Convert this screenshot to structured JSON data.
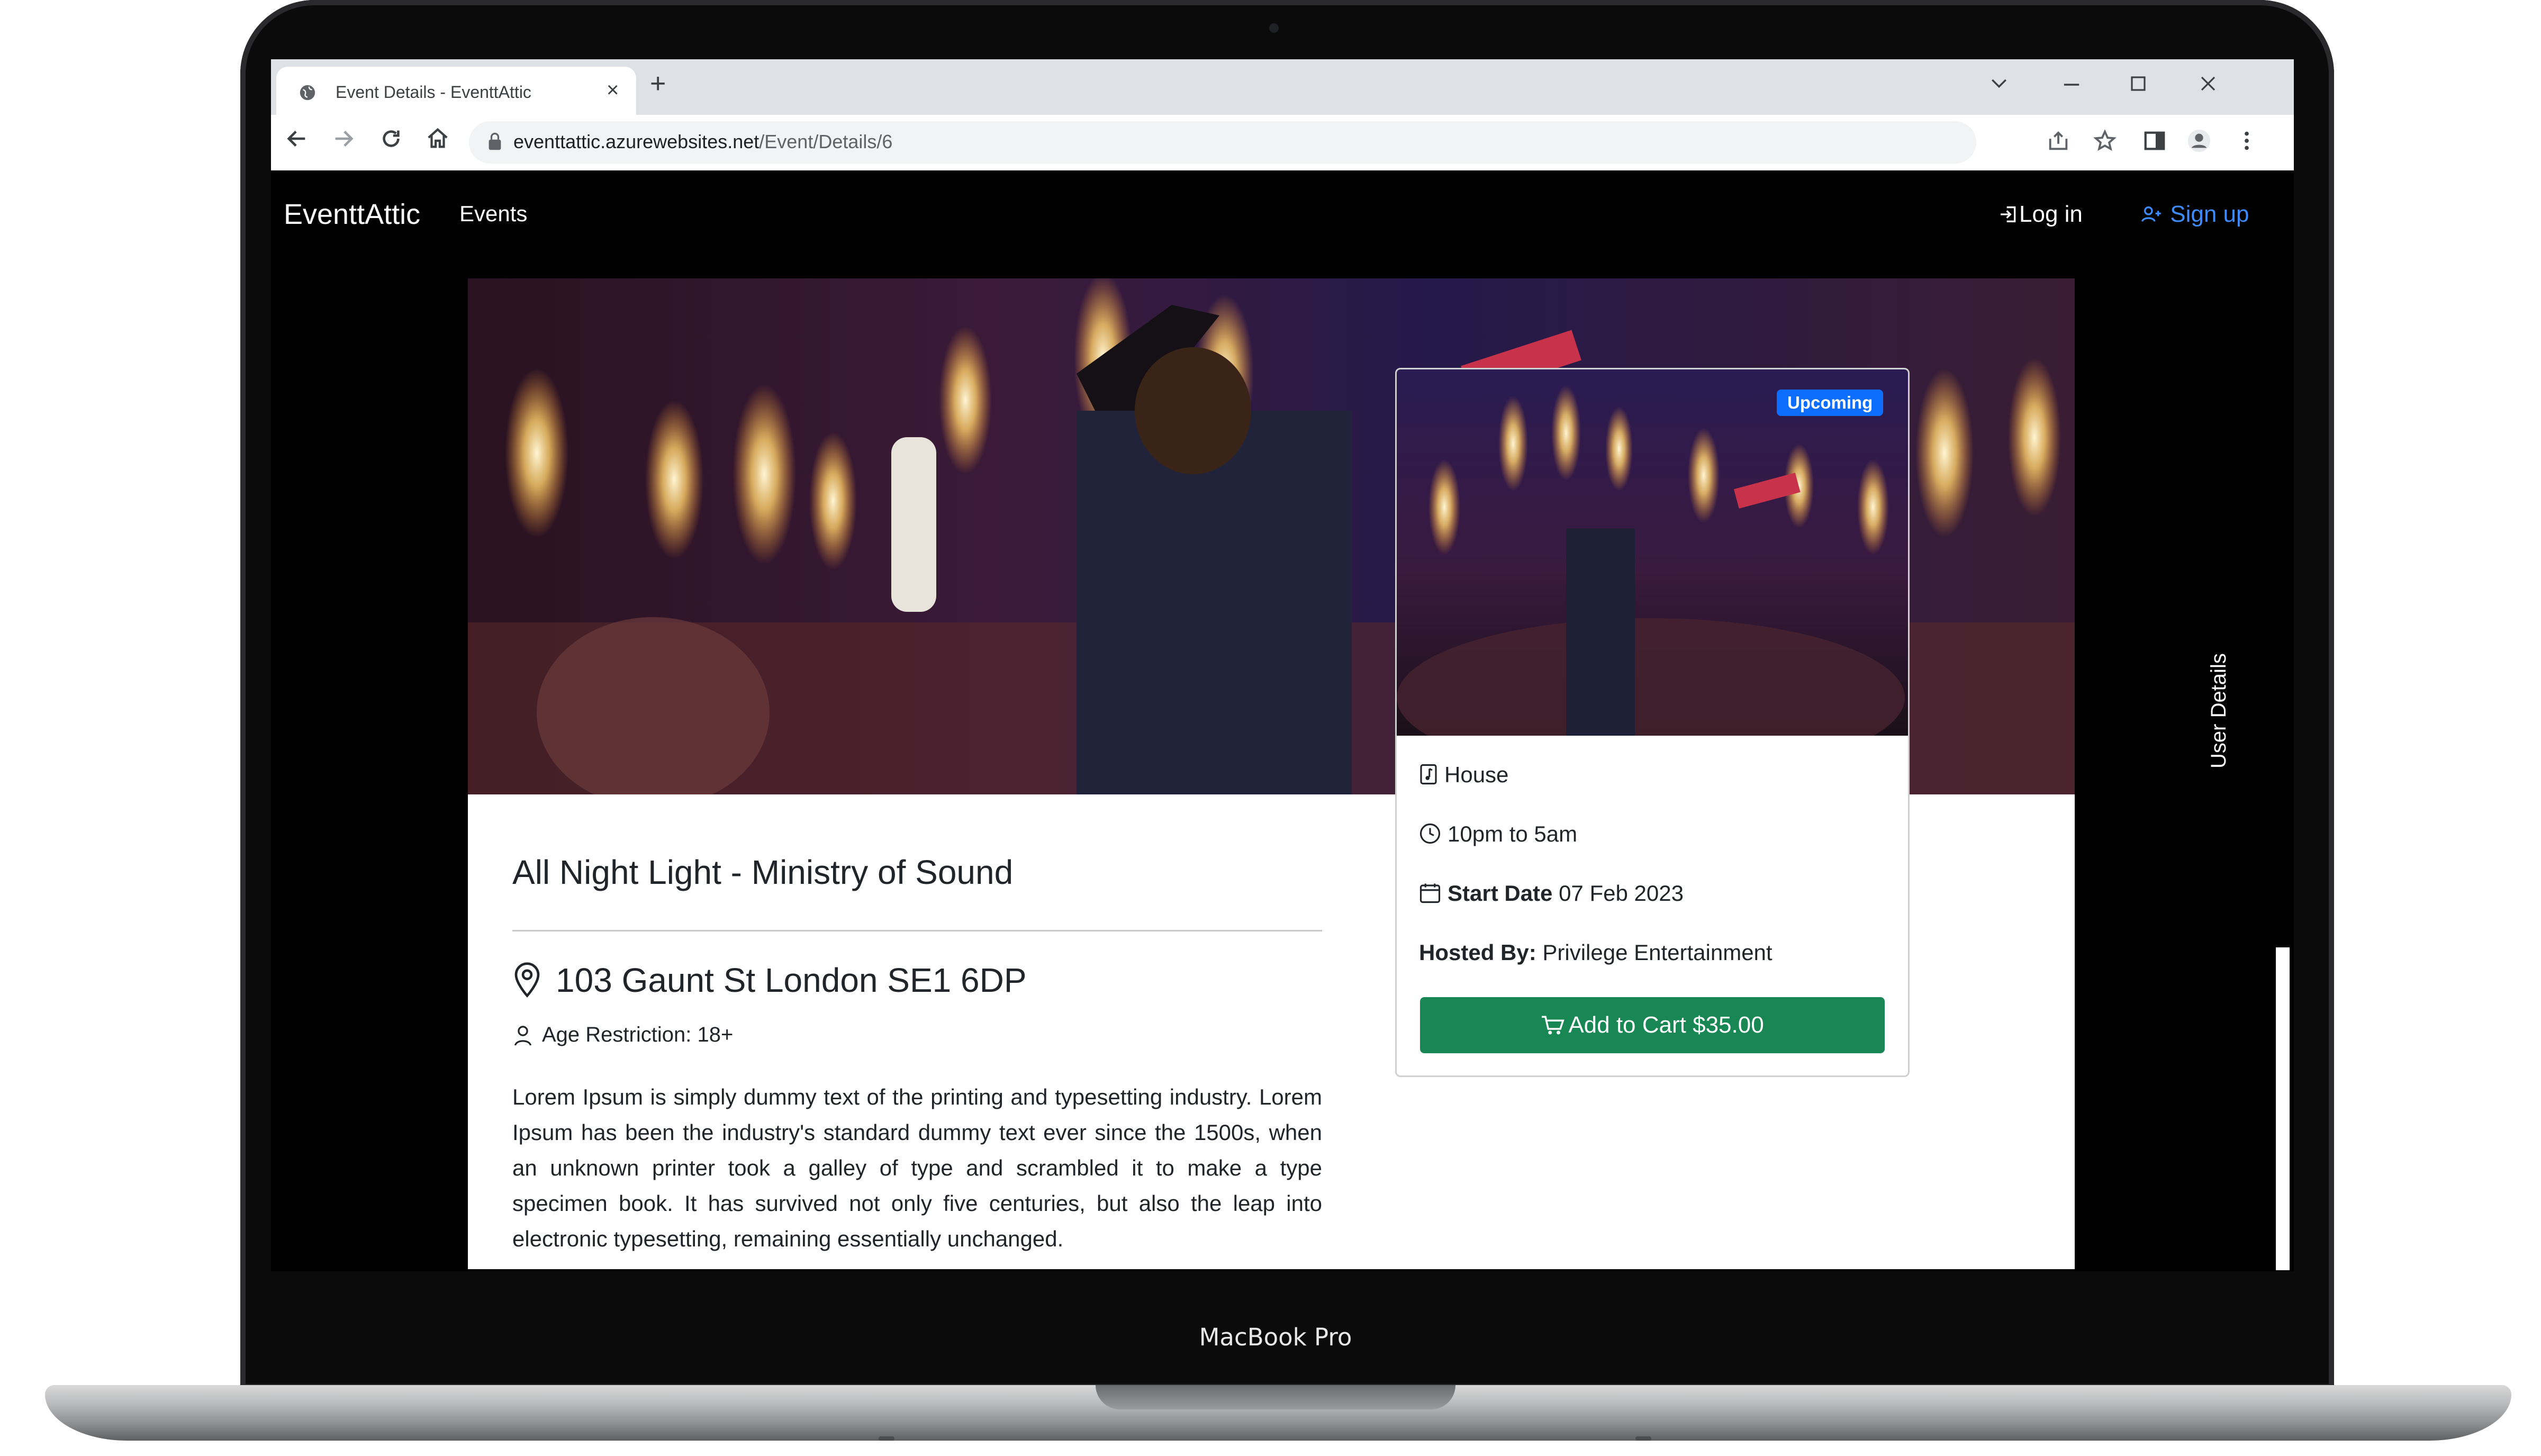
{
  "device": {
    "model_label": "MacBook Pro"
  },
  "browser": {
    "tab_title": "Event Details - EventtAttic",
    "url_host": "eventtattic.azurewebsites.net",
    "url_path": "/Event/Details/6",
    "tab_close_glyph": "×",
    "new_tab_glyph": "+",
    "icons": [
      "globe-icon",
      "close-icon",
      "plus-icon",
      "chevron-down-icon",
      "minimize-icon",
      "maximize-icon",
      "window-close-icon",
      "back-arrow-icon",
      "forward-arrow-icon",
      "reload-icon",
      "home-icon",
      "lock-icon",
      "share-icon",
      "star-icon",
      "side-panel-icon",
      "profile-icon",
      "kebab-menu-icon"
    ]
  },
  "site_nav": {
    "brand": "EventtAttic",
    "events_link": "Events",
    "login": "Log in",
    "signup": "Sign up",
    "signup_color": "#3d8bfd"
  },
  "event": {
    "title": "All Night Light - Ministry of Sound",
    "address": "103 Gaunt St London SE1 6DP",
    "age_restriction": "Age Restriction: 18+",
    "description": "Lorem Ipsum is simply dummy text of the printing and typesetting industry. Lorem Ipsum has been the industry's standard dummy text ever since the 1500s, when an unknown printer took a galley of type and scrambled it to make a type specimen book. It has survived not only five centuries, but also the leap into electronic typesetting, remaining essentially unchanged."
  },
  "card": {
    "badge": "Upcoming",
    "badge_color": "#0d6efd",
    "genre": "House",
    "time": "10pm to 5am",
    "start_date_label": "Start Date",
    "start_date": "07 Feb 2023",
    "hosted_by_label": "Hosted By:",
    "hosted_by": "Privilege Entertainment",
    "cart_button": "Add to Cart $35.00",
    "cart_color": "#198754"
  },
  "drawer": {
    "label": "User Details"
  }
}
